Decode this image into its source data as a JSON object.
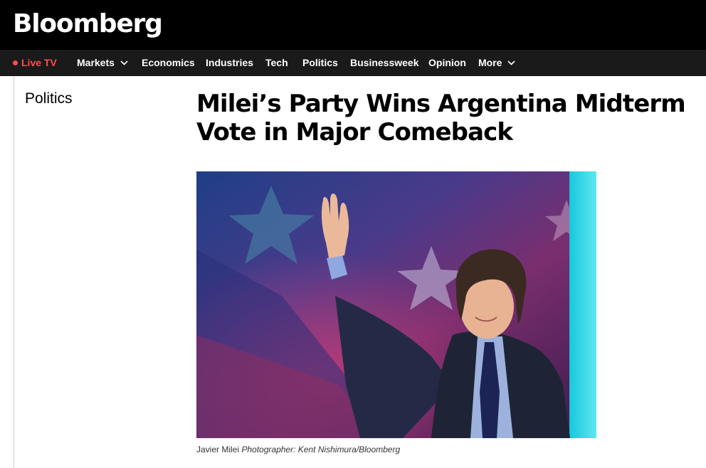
{
  "brand": {
    "logo": "Bloomberg",
    "background": "#000000",
    "accent": "#ff4d4d"
  },
  "nav": {
    "live": "Live TV",
    "items": [
      "Markets",
      "Economics",
      "Industries",
      "Tech",
      "Politics",
      "Businessweek",
      "Opinion",
      "More"
    ],
    "dropdown_items": [
      "Markets",
      "More"
    ]
  },
  "article": {
    "section": "Politics",
    "headline_line1": "Milei’s Party Wins Argentina Midterm",
    "headline_line2": "Vote in Major Comeback",
    "caption_subject": "Javier Milei",
    "caption_credit": "Photographer: Kent Nishimura/Bloomberg"
  },
  "icons": {
    "live_indicator": "live-dot-icon",
    "dropdown": "chevron-down-icon"
  }
}
